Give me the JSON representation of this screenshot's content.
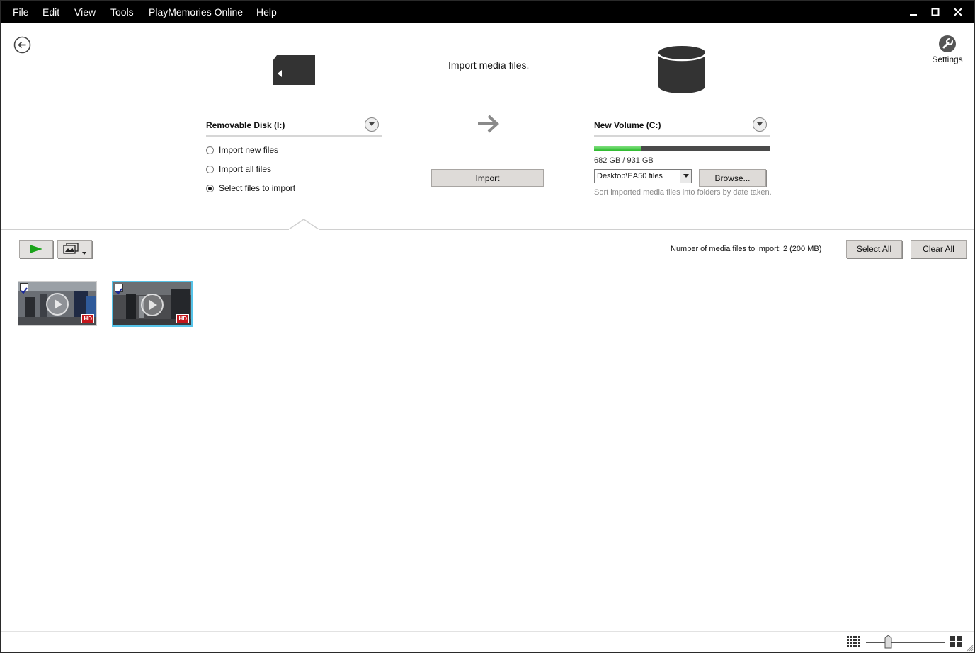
{
  "menu": {
    "items": [
      "File",
      "Edit",
      "View",
      "Tools",
      "PlayMemories Online",
      "Help"
    ]
  },
  "window_controls": {
    "minimize": "minimize-icon",
    "maximize": "maximize-icon",
    "close": "close-icon"
  },
  "header": {
    "title": "Import media files.",
    "settings_label": "Settings"
  },
  "source": {
    "device_label": "Removable Disk (I:)",
    "options": [
      {
        "label": "Import new files",
        "checked": false
      },
      {
        "label": "Import all files",
        "checked": false
      },
      {
        "label": "Select files to import",
        "checked": true
      }
    ]
  },
  "import_button_label": "Import",
  "destination": {
    "volume_label": "New Volume (C:)",
    "capacity_text": "682 GB / 931 GB",
    "capacity_fraction": 0.267,
    "folder_value": "Desktop\\EA50 files",
    "browse_label": "Browse...",
    "hint": "Sort imported media files into folders by date taken."
  },
  "toolbar": {
    "count_text": "Number of media files to import: 2 (200 MB)",
    "select_all_label": "Select All",
    "clear_all_label": "Clear All"
  },
  "thumbnails": [
    {
      "badge": "HD",
      "checked": true,
      "selected": false
    },
    {
      "badge": "HD",
      "checked": true,
      "selected": true
    }
  ],
  "colors": {
    "menubar": "#000000",
    "capacity_used": "#1db21d",
    "play_green": "#1aa31a",
    "hd_badge": "#c4161c",
    "selection": "#56c3e8"
  }
}
